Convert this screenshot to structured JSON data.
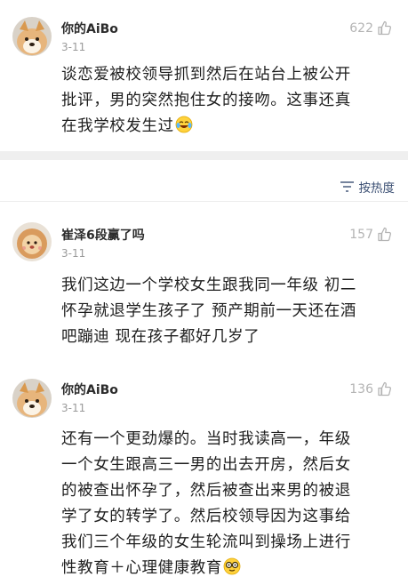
{
  "comments": [
    {
      "username": "你的AiBo",
      "date": "3-11",
      "likes": "622",
      "lines": [
        "谈恋爱被校领导抓到然后在站台上被公开",
        "批评，男的突然抱住女的接吻。这事还真",
        "在我学校发生过"
      ],
      "emoji": "laugh-cry-emoji"
    },
    {
      "username": "崔泽6段赢了吗",
      "date": "3-11",
      "likes": "157",
      "lines": [
        "我们这边一个学校女生跟我同一年级 初二",
        "怀孕就退学生孩子了 预产期前一天还在酒",
        "吧蹦迪 现在孩子都好几岁了"
      ]
    },
    {
      "username": "你的AiBo",
      "date": "3-11",
      "likes": "136",
      "lines": [
        "还有一个更劲爆的。当时我读高一，年级",
        "一个女生跟高三一男的出去开房，然后女",
        "的被查出怀孕了，然后被查出来男的被退",
        "学了女的转学了。然后校领导因为这事给",
        "我们三个年级的女生轮流叫到操场上进行",
        "性教育＋心理健康教育"
      ],
      "emoji": "nerd-glasses-emoji"
    }
  ],
  "sort": {
    "label": "按热度",
    "icon": "sort-icon"
  },
  "colors": {
    "link": "#3b4f73",
    "muted": "#9a9a9a",
    "divider": "#efefef"
  }
}
